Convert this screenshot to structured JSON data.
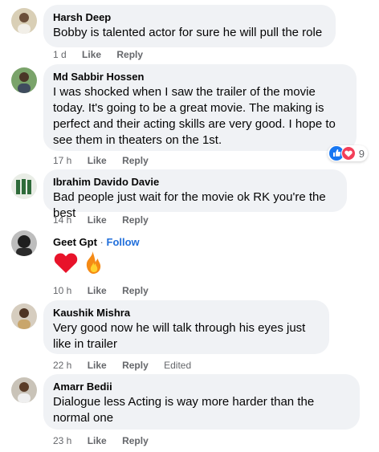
{
  "comments": [
    {
      "author": "Harsh Deep",
      "text": "Bobby is talented actor for sure he will pull the role",
      "time": "1 d",
      "like": "Like",
      "reply": "Reply"
    },
    {
      "author": "Md Sabbir Hossen",
      "text": "I was shocked when I saw the trailer of the movie today. It's going to be a great movie. The making is perfect and their acting skills are very good. I hope to see them in theaters on the 1st.",
      "time": "17 h",
      "like": "Like",
      "reply": "Reply",
      "reaction_count": "9"
    },
    {
      "author": "Ibrahim Davido Davie",
      "text": "Bad people just wait for the movie ok RK you're the best",
      "time": "14 h",
      "like": "Like",
      "reply": "Reply"
    },
    {
      "author": "Geet Gpt",
      "separator": "·",
      "follow": "Follow",
      "emojis": [
        "heart",
        "fire"
      ],
      "time": "10 h",
      "like": "Like",
      "reply": "Reply"
    },
    {
      "author": "Kaushik Mishra",
      "text": "Very good now he will talk through his eyes just like in trailer",
      "time": "22 h",
      "like": "Like",
      "reply": "Reply",
      "edited": "Edited"
    },
    {
      "author": "Amarr Bedii",
      "text": "Dialogue less Acting is way more harder than the normal one",
      "time": "23 h",
      "like": "Like",
      "reply": "Reply"
    }
  ],
  "colors": {
    "bubble": "#f0f2f5",
    "meta": "#65676b",
    "follow": "#216fdb",
    "like_reaction": "#1877f2",
    "love_reaction": "#f33e58"
  }
}
